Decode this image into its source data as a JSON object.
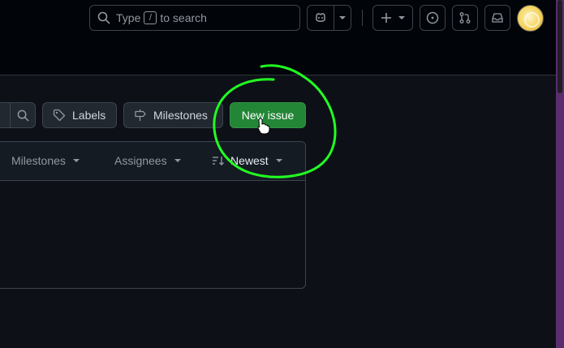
{
  "header": {
    "search": {
      "prefix": "Type",
      "key": "/",
      "suffix": "to search"
    },
    "icons": [
      "search-icon",
      "copilot-icon",
      "chevron-down-icon",
      "plus-icon",
      "issues-icon",
      "pull-request-icon",
      "inbox-icon"
    ]
  },
  "toolbar": {
    "labels_label": "Labels",
    "milestones_label": "Milestones",
    "new_issue_label": "New issue"
  },
  "filters": {
    "milestones": "Milestones",
    "assignees": "Assignees",
    "sort": "Newest"
  },
  "colors": {
    "accent_green": "#238636",
    "annotation": "#22ff22",
    "background": "#0d1117"
  }
}
